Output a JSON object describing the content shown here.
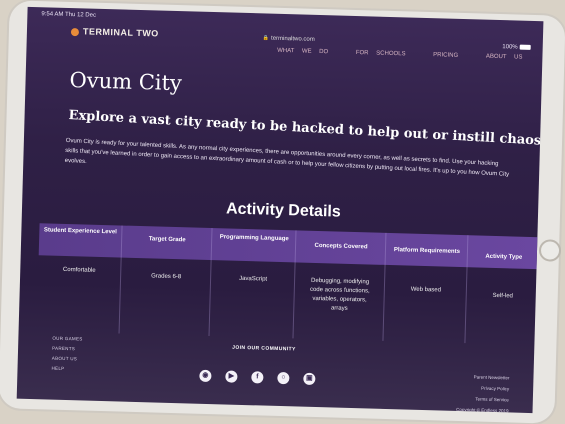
{
  "status": {
    "time": "9:54 AM  Thu 12 Dec",
    "url": "terminaltwo.com",
    "battery": "100%"
  },
  "site": {
    "logo": "TERMINAL TWO",
    "nav": [
      "WHAT WE DO",
      "FOR SCHOOLS",
      "PRICING",
      "ABOUT US"
    ]
  },
  "hero": {
    "title": "Ovum City",
    "subtitle": "Explore a vast city ready to be hacked to help out or instill chaos",
    "body": "Ovum City is ready for your talented skills. As any normal city experiences, there are opportunities around every corner, as well as secrets to find. Use your hacking skills that you've learned in order to gain access to an extraordinary amount of cash or to help your fellow citizens by putting out local fires. It's up to you how Ovum City evolves."
  },
  "activity": {
    "title": "Activity Details",
    "columns": [
      {
        "header": "Student Experience Level",
        "value": "Comfortable"
      },
      {
        "header": "Target Grade",
        "value": "Grades 6-8"
      },
      {
        "header": "Programming Language",
        "value": "JavaScript"
      },
      {
        "header": "Concepts Covered",
        "value": "Debugging, modifying code across functions, variables, operators, arrays"
      },
      {
        "header": "Platform Requirements",
        "value": "Web based"
      },
      {
        "header": "Activity Type",
        "value": "Self-led"
      }
    ]
  },
  "footer": {
    "links": [
      "OUR GAMES",
      "PARENTS",
      "ABOUT US",
      "HELP"
    ],
    "community": "JOIN OUR COMMUNITY",
    "socials": [
      "discord-icon",
      "youtube-icon",
      "facebook-icon",
      "instagram-icon",
      "twitch-icon"
    ],
    "right_links": [
      "Parent Newsletter",
      "Privacy Policy",
      "Terms of Service",
      "Copyright © Endless 2019"
    ]
  }
}
